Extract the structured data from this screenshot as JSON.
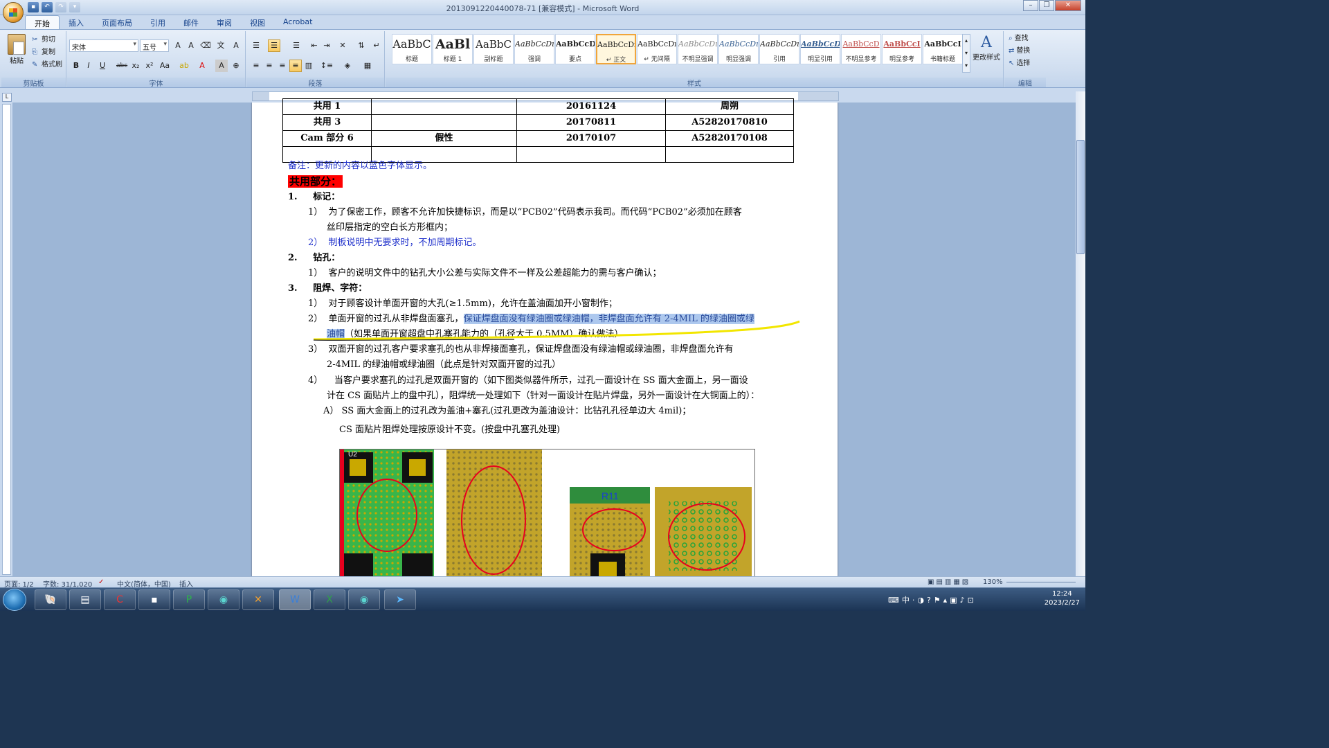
{
  "window": {
    "title": "2013091220440078-71 [兼容模式] - Microsoft Word"
  },
  "tabs": [
    "开始",
    "插入",
    "页面布局",
    "引用",
    "邮件",
    "审阅",
    "视图",
    "Acrobat"
  ],
  "ribbon": {
    "clipboard": {
      "paste": "粘贴",
      "cut": "剪切",
      "copy": "复制",
      "format_painter": "格式刷",
      "label": "剪贴板"
    },
    "font": {
      "name": "宋体",
      "size": "五号",
      "label": "字体"
    },
    "paragraph": {
      "label": "段落"
    },
    "styles": {
      "label": "样式",
      "items": [
        {
          "preview": "AaBbC",
          "name": "标题"
        },
        {
          "preview": "AaBl",
          "name": "标题 1"
        },
        {
          "preview": "AaBbC",
          "name": "副标题"
        },
        {
          "preview": "AaBbCcDı",
          "name": "强调"
        },
        {
          "preview": "AaBbCcD",
          "name": "要点"
        },
        {
          "preview": "AaBbCcDı",
          "name": "↵ 正文"
        },
        {
          "preview": "AaBbCcDı",
          "name": "↵ 无间隔"
        },
        {
          "preview": "AaBbCcDı",
          "name": "不明显强调"
        },
        {
          "preview": "AaBbCcDı",
          "name": "明显强调"
        },
        {
          "preview": "AaBbCcDı",
          "name": "引用"
        },
        {
          "preview": "AaBbCcDı",
          "name": "明显引用"
        },
        {
          "preview": "AaBbCcD",
          "name": "不明显参考"
        },
        {
          "preview": "AaBbCcI",
          "name": "明显参考"
        },
        {
          "preview": "AaBbCcI",
          "name": "书籍标题"
        }
      ],
      "change": "更改样式"
    },
    "editing": {
      "find": "查找",
      "replace": "替换",
      "select": "选择",
      "label": "编辑"
    }
  },
  "document": {
    "table_rows": [
      [
        "共用 1",
        "",
        "20161124",
        "周朔"
      ],
      [
        "共用 3",
        "",
        "20170811",
        "A52820170810"
      ],
      [
        "Cam 部分 6",
        "假性",
        "20170107",
        "A52820170108"
      ],
      [
        "",
        "",
        "",
        ""
      ]
    ],
    "note": "备注：更新的内容以蓝色字体显示。",
    "section_title": "共用部分：",
    "s1_title": "标记：",
    "s1_1a": "为了保密工作，顾客不允许加快捷标识，而是以“PCB02”代码表示我司。而代码“PCB02”必须加在顾客",
    "s1_1b": "丝印层指定的空白长方形框内；",
    "s1_2": "制板说明中无要求时，不加周期标记。",
    "s2_title": "钻孔：",
    "s2_1": "客户的说明文件中的钻孔大小公差与实际文件不一样及公差超能力的需与客户确认；",
    "s3_title": "阻焊、字符：",
    "s3_1": "对于顾客设计单面开窗的大孔(≥1.5mm)，允许在盖油面加开小窗制作；",
    "s3_2a": "单面开窗的过孔从非焊盘面塞孔，",
    "s3_2hl": "保证焊盘面没有绿油圈或绿油帽，非焊盘面允许有 2-4MIL 的绿油圈或绿",
    "s3_2hl2": "油帽",
    "s3_2b": "（如果单面开窗超盘中孔塞孔能力的（孔径大于 0.5MM）确认做法）",
    "s3_3a": "双面开窗的过孔客户要求塞孔的也从非焊接面塞孔，保证焊盘面没有绿油帽或绿油圈，非焊盘面允许有",
    "s3_3b": "2-4MIL 的绿油帽或绿油圈（此点是针对双面开窗的过孔）",
    "s3_4a": "当客户要求塞孔的过孔是双面开窗的（如下图类似器件所示，过孔一面设计在 SS 面大金面上，另一面设",
    "s3_4b": "计在 CS 面贴片上的盘中孔），阻焊统一处理如下（针对一面设计在贴片焊盘，另外一面设计在大铜面上的）：",
    "s3_4A": "A） SS 面大金面上的过孔改为盖油+塞孔(过孔更改为盖油设计：比钻孔孔径单边大 4mil)；",
    "s3_4B": "CS 面贴片阻焊处理按原设计不变。(按盘中孔塞孔处理)",
    "fig_label_r11": "R11",
    "fig_label_u2": "U2"
  },
  "status": {
    "page": "页面: 1/2",
    "words": "字数: 31/1,020",
    "lang": "中文(简体，中国)",
    "mode": "插入",
    "zoom": "130%"
  },
  "tray": {
    "time": "12:24",
    "date": "2023/2/27"
  },
  "colors": {
    "highlight": "#adc8ee",
    "note_blue": "#2233cc",
    "title_red": "#ff0000"
  }
}
